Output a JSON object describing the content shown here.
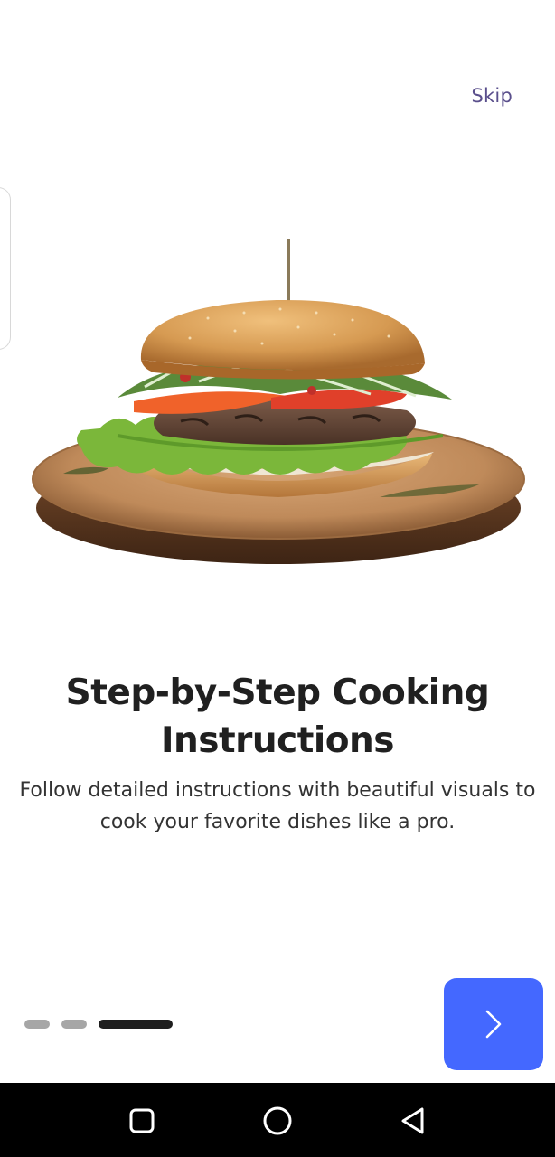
{
  "header": {
    "skip_label": "Skip"
  },
  "hero": {
    "image": "burger-on-wooden-board-icon"
  },
  "onboarding": {
    "title": "Step-by-Step Cooking Instructions",
    "description": "Follow detailed instructions with beautiful visuals to cook your favorite dishes like a pro."
  },
  "pager": {
    "total": 3,
    "current": 3
  },
  "next_button": {
    "icon": "chevron-right-icon"
  },
  "system_nav": {
    "buttons": [
      "recents-icon",
      "home-icon",
      "back-icon"
    ]
  },
  "colors": {
    "accent": "#4468ff",
    "skip": "#5a4f8c",
    "nav_bar": "#000000"
  }
}
